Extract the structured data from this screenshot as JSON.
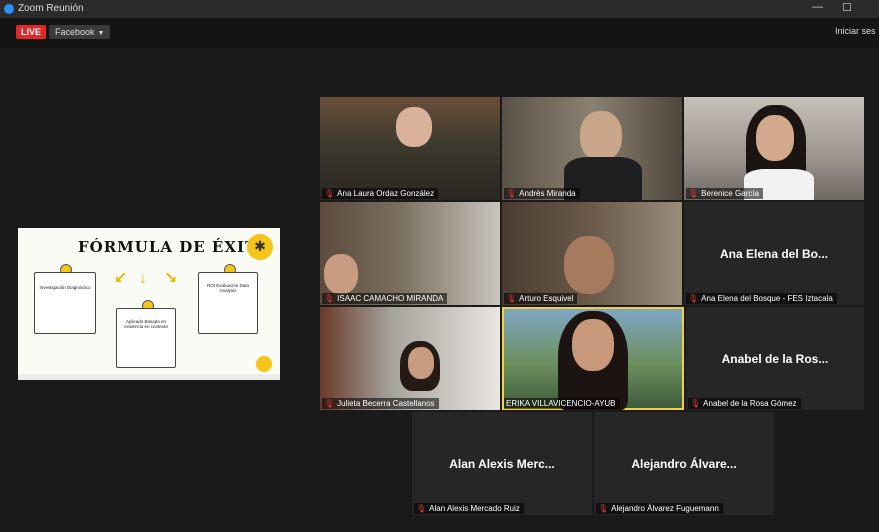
{
  "window": {
    "title": "Zoom Reunión"
  },
  "toolbar": {
    "live_label": "LIVE",
    "platform_label": "Facebook",
    "start_label": "Iniciar ses"
  },
  "share": {
    "title": "FÓRMULA DE ÉXITO",
    "cards": [
      "Investigación Diagnóstico",
      "Aplicado Basado en evidencia en contexto",
      "ROI Evaluación Data Analysis"
    ]
  },
  "participants": [
    {
      "name": "Ana Laura Ordaz González"
    },
    {
      "name": "Andrés Miranda"
    },
    {
      "name": "Berenice García"
    },
    {
      "name": "ISAAC CAMACHO MIRANDA"
    },
    {
      "name": "Arturo Esquivel"
    },
    {
      "name": "Ana Elena del Bosque - FES Iztacala",
      "display": "Ana Elena del Bo..."
    },
    {
      "name": "Julieta Becerra Castellanos"
    },
    {
      "name": "ERIKA VILLAVICENCIO-AYUB"
    },
    {
      "name": "Anabel de la Rosa Gómez",
      "display": "Anabel de la Ros..."
    },
    {
      "name": "Alan Alexis Mercado Ruiz",
      "display": "Alan Alexis Merc..."
    },
    {
      "name": "Alejandro Álvarez Fuguemann",
      "display": "Alejandro Álvare..."
    }
  ]
}
